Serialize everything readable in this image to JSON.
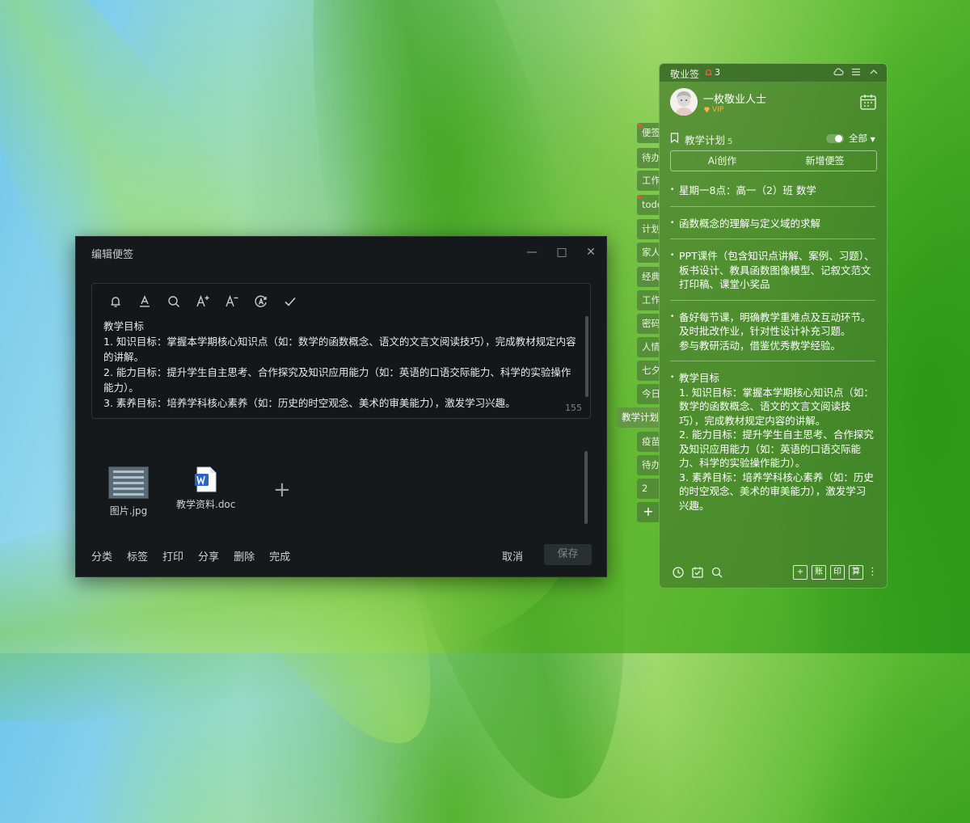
{
  "edit_dialog": {
    "title": "编辑便签",
    "content": "教学目标\n1. 知识目标：掌握本学期核心知识点（如：数学的函数概念、语文的文言文阅读技巧），完成教材规定内容的讲解。\n2. 能力目标：提升学生自主思考、合作探究及知识应用能力（如：英语的口语交际能力、科学的实验操作能力）。\n3. 素养目标：培养学科核心素养（如：历史的时空观念、美术的审美能力），激发学习兴趣。",
    "char_count": "155",
    "attachments": [
      {
        "name": "图片.jpg",
        "type": "image"
      },
      {
        "name": "教学资料.doc",
        "type": "doc"
      }
    ],
    "actions": [
      "分类",
      "标签",
      "打印",
      "分享",
      "删除",
      "完成"
    ],
    "cancel": "取消",
    "save": "保存"
  },
  "side_tabs": [
    {
      "label": "便签",
      "dot": true
    },
    {
      "label": "待办",
      "dot": false
    },
    {
      "label": "工作",
      "dot": false
    },
    {
      "label": "todo",
      "dot": true
    },
    {
      "label": "计划",
      "dot": false
    },
    {
      "label": "家人",
      "dot": false
    },
    {
      "label": "经典",
      "dot": false
    },
    {
      "label": "工作",
      "dot": false
    },
    {
      "label": "密码",
      "dot": false
    },
    {
      "label": "人情",
      "dot": false
    },
    {
      "label": "七夕",
      "dot": false
    },
    {
      "label": "今日",
      "dot": false
    },
    {
      "label": "教学计划",
      "dot": false,
      "active": true
    },
    {
      "label": "疫苗",
      "dot": false
    },
    {
      "label": "待办",
      "dot": false
    },
    {
      "label": "2",
      "dot": false
    }
  ],
  "side_add_label": "+",
  "panel": {
    "app_name": "敬业签",
    "reminder_count": "3",
    "user_name": "一枚敬业人士",
    "vip_label": "VIP",
    "list_title": "教学计划",
    "list_count": "5",
    "filter_label": "全部",
    "ai_button": "Ai创作",
    "new_note_button": "新增便签",
    "notes": [
      "星期一8点：高一（2）班 数学",
      "函数概念的理解与定义域的求解",
      "PPT课件（包含知识点讲解、案例、习题）、板书设计、教具函数图像模型、记叙文范文打印稿、课堂小奖品",
      "备好每节课，明确教学重难点及互动环节。\n及时批改作业，针对性设计补充习题。\n参与教研活动，借鉴优秀教学经验。",
      "教学目标\n1. 知识目标：掌握本学期核心知识点（如：数学的函数概念、语文的文言文阅读技巧），完成教材规定内容的讲解。\n2. 能力目标：提升学生自主思考、合作探究及知识应用能力（如：英语的口语交际能力、科学的实验操作能力）。\n3. 素养目标：培养学科核心素养（如：历史的时空观念、美术的审美能力），激发学习兴趣。"
    ],
    "bottom_buttons": [
      "+",
      "账",
      "印",
      "算"
    ]
  },
  "colors": {
    "dialog_bg": "#16191b",
    "panel_green": "#467d2d",
    "dot_red": "#ff4b3e",
    "vip_orange": "#ffb04a"
  }
}
